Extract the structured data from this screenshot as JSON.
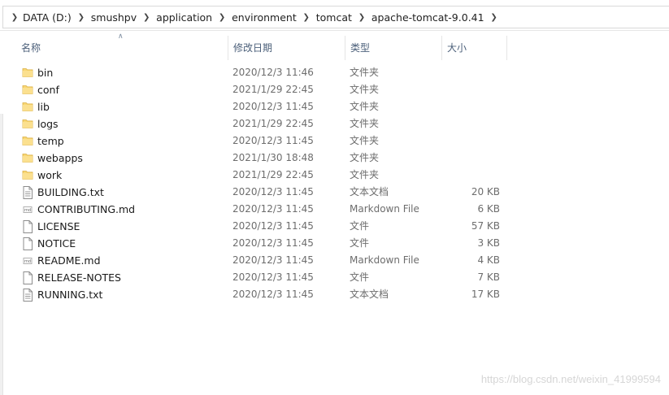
{
  "breadcrumb": {
    "items": [
      "DATA (D:)",
      "smushpv",
      "application",
      "environment",
      "tomcat",
      "apache-tomcat-9.0.41"
    ]
  },
  "columns": {
    "name": "名称",
    "date": "修改日期",
    "type": "类型",
    "size": "大小"
  },
  "files": [
    {
      "name": "bin",
      "date": "2020/12/3 11:46",
      "type": "文件夹",
      "size": "",
      "icon": "folder-icon"
    },
    {
      "name": "conf",
      "date": "2021/1/29 22:45",
      "type": "文件夹",
      "size": "",
      "icon": "folder-icon"
    },
    {
      "name": "lib",
      "date": "2020/12/3 11:45",
      "type": "文件夹",
      "size": "",
      "icon": "folder-icon"
    },
    {
      "name": "logs",
      "date": "2021/1/29 22:45",
      "type": "文件夹",
      "size": "",
      "icon": "folder-icon"
    },
    {
      "name": "temp",
      "date": "2020/12/3 11:45",
      "type": "文件夹",
      "size": "",
      "icon": "folder-icon"
    },
    {
      "name": "webapps",
      "date": "2021/1/30 18:48",
      "type": "文件夹",
      "size": "",
      "icon": "folder-icon"
    },
    {
      "name": "work",
      "date": "2021/1/29 22:45",
      "type": "文件夹",
      "size": "",
      "icon": "folder-icon"
    },
    {
      "name": "BUILDING.txt",
      "date": "2020/12/3 11:45",
      "type": "文本文档",
      "size": "20 KB",
      "icon": "text-file-icon"
    },
    {
      "name": "CONTRIBUTING.md",
      "date": "2020/12/3 11:45",
      "type": "Markdown File",
      "size": "6 KB",
      "icon": "markdown-file-icon"
    },
    {
      "name": "LICENSE",
      "date": "2020/12/3 11:45",
      "type": "文件",
      "size": "57 KB",
      "icon": "file-icon"
    },
    {
      "name": "NOTICE",
      "date": "2020/12/3 11:45",
      "type": "文件",
      "size": "3 KB",
      "icon": "file-icon"
    },
    {
      "name": "README.md",
      "date": "2020/12/3 11:45",
      "type": "Markdown File",
      "size": "4 KB",
      "icon": "markdown-file-icon"
    },
    {
      "name": "RELEASE-NOTES",
      "date": "2020/12/3 11:45",
      "type": "文件",
      "size": "7 KB",
      "icon": "file-icon"
    },
    {
      "name": "RUNNING.txt",
      "date": "2020/12/3 11:45",
      "type": "文本文档",
      "size": "17 KB",
      "icon": "text-file-icon"
    }
  ],
  "watermark": "https://blog.csdn.net/weixin_41999594",
  "colors": {
    "folder": "#f8d775",
    "header_text": "#4c607a"
  }
}
